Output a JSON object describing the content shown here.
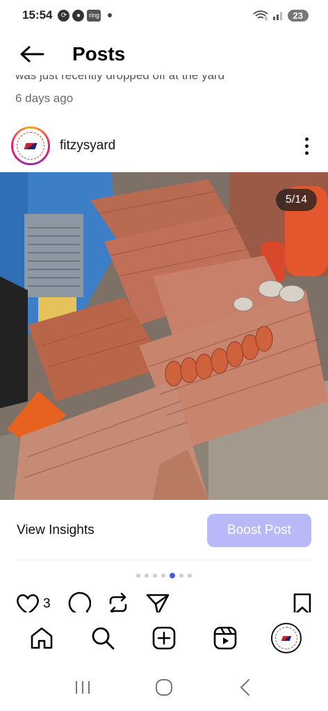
{
  "status_bar": {
    "time": "15:54",
    "ring_label": "ring",
    "wifi_label": "6",
    "battery": "23"
  },
  "header": {
    "title": "Posts"
  },
  "previous_post": {
    "caption_fragment": "was just recently dropped off at the yard",
    "timestamp": "6 days ago"
  },
  "post": {
    "username": "fitzysyard",
    "image_counter": "5/14",
    "current_slide": 5,
    "total_slides": 14,
    "like_count": "3"
  },
  "insights": {
    "view_label": "View Insights",
    "boost_label": "Boost Post"
  },
  "colors": {
    "boost_button": "#b9b8f9",
    "active_dot": "#4a5bd4"
  },
  "icons": {
    "back": "arrow-left-icon",
    "more": "more-vertical-icon",
    "like": "heart-icon",
    "comment": "comment-icon",
    "repost": "repost-icon",
    "share": "send-icon",
    "save": "bookmark-icon",
    "home": "home-icon",
    "search": "search-icon",
    "create": "plus-square-icon",
    "reels": "reels-icon"
  }
}
